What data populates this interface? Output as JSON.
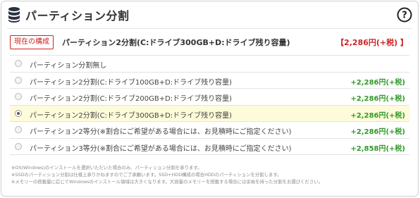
{
  "header": {
    "title": "パーティション分割",
    "icon": "database-icon",
    "help_icon": "help-icon"
  },
  "current": {
    "badge": "現在の構成",
    "name": "パーティション2分割(C:ドライブ300GB+D:ドライブ残り容量)",
    "price": "【2,286円(+税) 】"
  },
  "options": [
    {
      "label": "パーティション分割無し",
      "price": "",
      "selected": false
    },
    {
      "label": "パーティション2分割(C:ドライブ100GB+D:ドライブ残り容量)",
      "price": "+2,286円(+税)",
      "selected": false
    },
    {
      "label": "パーティション2分割(C:ドライブ200GB+D:ドライブ残り容量)",
      "price": "+2,286円(+税)",
      "selected": false
    },
    {
      "label": "パーティション2分割(C:ドライブ300GB+D:ドライブ残り容量)",
      "price": "+2,286円(+税)",
      "selected": true
    },
    {
      "label": "パーティション2等分(※割合にご希望がある場合には、お見積時にご指定ください)",
      "price": "+2,286円(+税)",
      "selected": false
    },
    {
      "label": "パーティション3等分(※割合にご希望がある場合には、お見積時にご指定ください)",
      "price": "+2,858円(+税)",
      "selected": false
    }
  ],
  "notes": [
    "※OS(Windows)のインストールを選択いただいた場合のみ、パーティション分割を承ります。",
    "※SSDのパーティション分割は仕様上承りかねますのでご了承願います。SSD+HDD構成の場合HDDのパーティションを分割します。",
    "※メモリーの搭載量に応じてWindowsのインストール領域は大きくなります。大容量のメモリーを搭載する場合には余裕を持った分割をお選びください。"
  ],
  "colors": {
    "accent_red": "#cc2222",
    "price_green": "#2f9a28",
    "selected_bg": "#fdfbd9"
  }
}
